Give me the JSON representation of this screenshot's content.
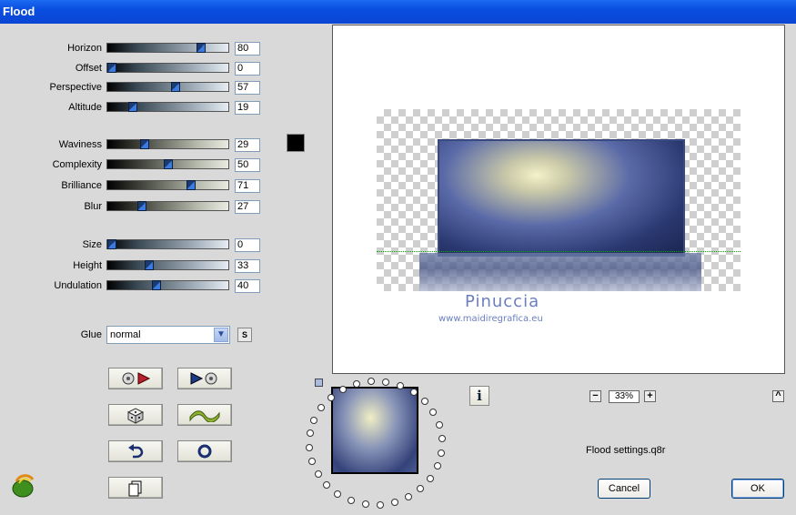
{
  "window": {
    "title": "Flood"
  },
  "sliders": [
    {
      "id": "horizon",
      "label": "Horizon",
      "value": "80",
      "fraction": 0.8,
      "group": 1
    },
    {
      "id": "offset",
      "label": "Offset",
      "value": "0",
      "fraction": 0.0,
      "group": 1
    },
    {
      "id": "perspective",
      "label": "Perspective",
      "value": "57",
      "fraction": 0.57,
      "group": 1
    },
    {
      "id": "altitude",
      "label": "Altitude",
      "value": "19",
      "fraction": 0.19,
      "group": 1
    },
    {
      "id": "waviness",
      "label": "Waviness",
      "value": "29",
      "fraction": 0.29,
      "group": 2
    },
    {
      "id": "complexity",
      "label": "Complexity",
      "value": "50",
      "fraction": 0.5,
      "group": 2
    },
    {
      "id": "brilliance",
      "label": "Brilliance",
      "value": "71",
      "fraction": 0.71,
      "group": 2
    },
    {
      "id": "blur",
      "label": "Blur",
      "value": "27",
      "fraction": 0.27,
      "group": 2
    },
    {
      "id": "size",
      "label": "Size",
      "value": "0",
      "fraction": 0.0,
      "group": 1
    },
    {
      "id": "height",
      "label": "Height",
      "value": "33",
      "fraction": 0.33,
      "group": 1
    },
    {
      "id": "undulation",
      "label": "Undulation",
      "value": "40",
      "fraction": 0.4,
      "group": 1
    }
  ],
  "color_swatch": {
    "color": "#000000"
  },
  "glue": {
    "label": "Glue",
    "selected": "normal",
    "side_button": "S"
  },
  "tool_buttons": {
    "load": "load-preset-icon",
    "save": "save-preset-icon",
    "random": "dice-icon",
    "wave": "wave-icon",
    "undo": "undo-icon",
    "reset": "reset-icon",
    "copy": "copy-icon"
  },
  "preview": {
    "watermark_title": "Pinuccia",
    "watermark_url": "www.maidiregrafica.eu"
  },
  "zoom": {
    "minus": "−",
    "value": "33%",
    "plus": "+"
  },
  "info_button": "i",
  "collapse_button": "^",
  "settings_file": "Flood settings.q8r",
  "buttons": {
    "cancel": "Cancel",
    "ok": "OK"
  },
  "colors": {
    "titlebar": "#0a4ee0",
    "watermark": "#6a7ec0"
  }
}
